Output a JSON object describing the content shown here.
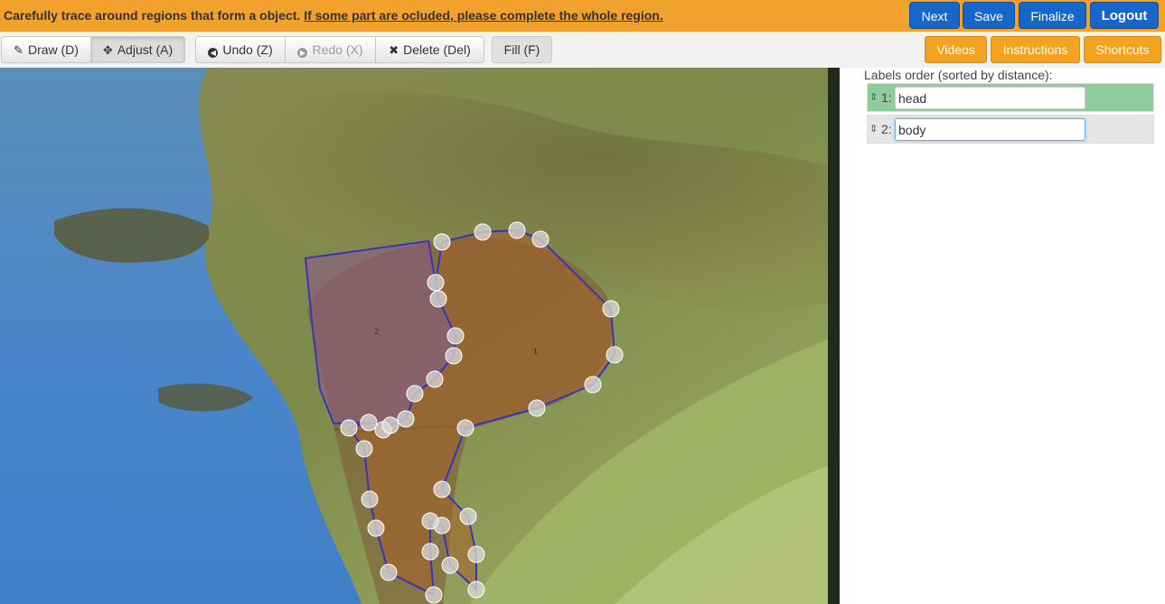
{
  "header": {
    "instruction_prefix": "Carefully trace around regions that form a object.",
    "instruction_link": "If some part are ocluded, please complete the whole region.",
    "buttons": {
      "next": "Next",
      "save": "Save",
      "finalize": "Finalize",
      "logout": "Logout"
    }
  },
  "toolbar": {
    "draw": "Draw (D)",
    "adjust": "Adjust (A)",
    "undo": "Undo (Z)",
    "redo": "Redo (X)",
    "delete": "Delete (Del)",
    "fill": "Fill (F)",
    "videos": "Videos",
    "instructions": "Instructions",
    "shortcuts": "Shortcuts",
    "icons": {
      "draw": "pencil-icon",
      "adjust": "move-icon",
      "undo": "undo-icon",
      "redo": "redo-icon",
      "delete": "x-icon"
    }
  },
  "canvas": {
    "region_labels": [
      "1",
      "2"
    ]
  },
  "labels_panel": {
    "title": "Labels order (sorted by distance):",
    "items": [
      {
        "index": "1:",
        "value": "head",
        "selected": true
      },
      {
        "index": "2:",
        "value": "body",
        "selected": false
      }
    ]
  },
  "colors": {
    "top_bar": "#f0a22c",
    "primary_button": "#1667c9",
    "orange_button": "#f4a321",
    "selected_row": "#8fcc9c",
    "polygon_stroke": "#3a35b8"
  }
}
